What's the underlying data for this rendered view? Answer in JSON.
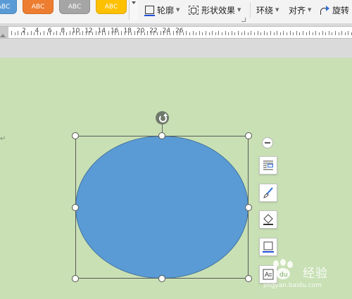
{
  "toolbar": {
    "style_samples": [
      "ABC",
      "ABC",
      "ABC",
      "ABC"
    ],
    "outline_label": "轮廓",
    "shape_effects_label": "形状效果",
    "wrap_label": "环绕",
    "align_label": "对齐",
    "rotate_label": "旋转"
  },
  "ruler": {
    "labels": [
      "2",
      "4",
      "6",
      "8",
      "10",
      "12",
      "14",
      "16",
      "18",
      "20",
      "22",
      "24",
      "26"
    ]
  },
  "document": {
    "paragraph_mark": "↵"
  },
  "shape": {
    "fill_color": "#5b9bd5",
    "outline_color": "#41719c"
  },
  "watermark": {
    "text": "经验",
    "url": "jingyan.baidu.com"
  },
  "colors": {
    "page_background": "#c8e0b4",
    "toolbar_background": "#f3f3f3",
    "style_blue": "#5b9bd5",
    "style_orange": "#ed7d31",
    "style_gray": "#a5a5a5",
    "style_yellow": "#ffc000"
  }
}
